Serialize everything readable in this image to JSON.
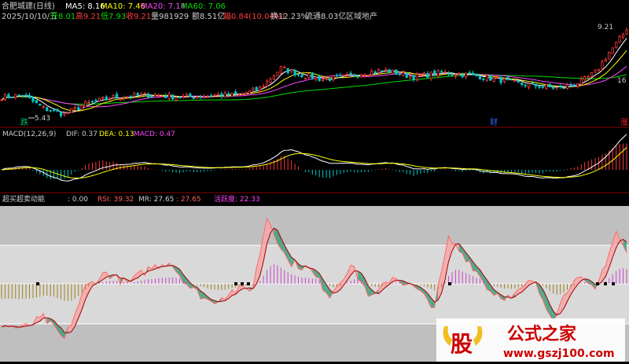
{
  "colors": {
    "background": "#000000",
    "up": "#ff3b3b",
    "down": "#00c8c8",
    "ma5": "#ffffff",
    "ma10": "#ffff00",
    "ma20": "#ff44ff",
    "ma60": "#00dd00",
    "label": "#cccccc",
    "separator": "#8b0000",
    "osc_band": "#d9d9d9",
    "osc_mid": "#c8c8c8",
    "osc_fill_up": "#f4a7a7",
    "osc_fill_down": "#3aa07a",
    "watermark_red": "#cc0000",
    "watermark_gold": "#f0c020"
  },
  "header": {
    "title": "合肥城建(日线)",
    "ma5": "MA5: 8.16",
    "ma10": "MA10: 7.46",
    "ma20": "MA20: 7.14",
    "ma60": "MA60: 7.06",
    "date": "2025/10/10/五",
    "open": "开8.01",
    "high": "高9.21",
    "low": "低7.93",
    "close": "收9.21",
    "volume": "量981929",
    "amount": "额8.51亿",
    "change": "幅0.84(10.04%)",
    "turnover": "换12.23%",
    "float": "流通8.03亿",
    "industry": "区域地产"
  },
  "price_panel": {
    "high_label": "9.21",
    "low_label": "5.43",
    "right_label": "16",
    "markers": [
      {
        "text": "跌",
        "color": "#00c060"
      },
      {
        "text": "财",
        "color": "#3366ff"
      },
      {
        "text": "涨",
        "color": "#ff2020"
      }
    ]
  },
  "macd": {
    "title": "MACD(12,26,9)",
    "dif": "DIF: 0.37",
    "dea": "DEA: 0.13",
    "macd": "MACD: 0.47"
  },
  "osc": {
    "title": "超买超卖动能",
    "value": ": 0.00",
    "rsi": "RSI: 39.32",
    "mr": "MR: 27.65",
    "mr2": ": 27.65",
    "active": "活跃度: 22.33"
  },
  "watermark": {
    "logo": "股",
    "name": "公式之家",
    "url": "www.gszj100.com"
  },
  "chart_data": {
    "type": "line",
    "x_count": 180,
    "price_range": [
      5.2,
      9.5
    ],
    "price_keypoints": [
      [
        0,
        6.2
      ],
      [
        6,
        6.3
      ],
      [
        12,
        5.7
      ],
      [
        18,
        5.43
      ],
      [
        24,
        5.9
      ],
      [
        32,
        6.2
      ],
      [
        42,
        6.3
      ],
      [
        52,
        6.2
      ],
      [
        62,
        6.3
      ],
      [
        68,
        6.3
      ],
      [
        74,
        6.6
      ],
      [
        80,
        7.5
      ],
      [
        86,
        7.2
      ],
      [
        92,
        7.0
      ],
      [
        98,
        7.1
      ],
      [
        104,
        7.3
      ],
      [
        110,
        7.4
      ],
      [
        118,
        7.1
      ],
      [
        126,
        7.3
      ],
      [
        134,
        7.2
      ],
      [
        142,
        7.0
      ],
      [
        148,
        6.8
      ],
      [
        154,
        6.7
      ],
      [
        160,
        6.6
      ],
      [
        166,
        6.9
      ],
      [
        170,
        7.3
      ],
      [
        174,
        8.2
      ],
      [
        179,
        9.21
      ]
    ],
    "macd_range": [
      -0.6,
      0.6
    ],
    "osc_range": [
      -80,
      100
    ],
    "osc_keypoints": [
      [
        0,
        -55
      ],
      [
        6,
        -60
      ],
      [
        12,
        -45
      ],
      [
        18,
        -75
      ],
      [
        24,
        -5
      ],
      [
        30,
        15
      ],
      [
        36,
        0
      ],
      [
        42,
        20
      ],
      [
        48,
        30
      ],
      [
        54,
        -5
      ],
      [
        60,
        -25
      ],
      [
        66,
        -10
      ],
      [
        72,
        -5
      ],
      [
        76,
        90
      ],
      [
        82,
        30
      ],
      [
        88,
        20
      ],
      [
        94,
        -15
      ],
      [
        100,
        25
      ],
      [
        106,
        -20
      ],
      [
        112,
        10
      ],
      [
        118,
        -5
      ],
      [
        124,
        -30
      ],
      [
        128,
        60
      ],
      [
        134,
        30
      ],
      [
        140,
        -10
      ],
      [
        146,
        -20
      ],
      [
        152,
        5
      ],
      [
        158,
        -45
      ],
      [
        164,
        10
      ],
      [
        170,
        -10
      ],
      [
        176,
        70
      ],
      [
        179,
        40
      ]
    ]
  }
}
